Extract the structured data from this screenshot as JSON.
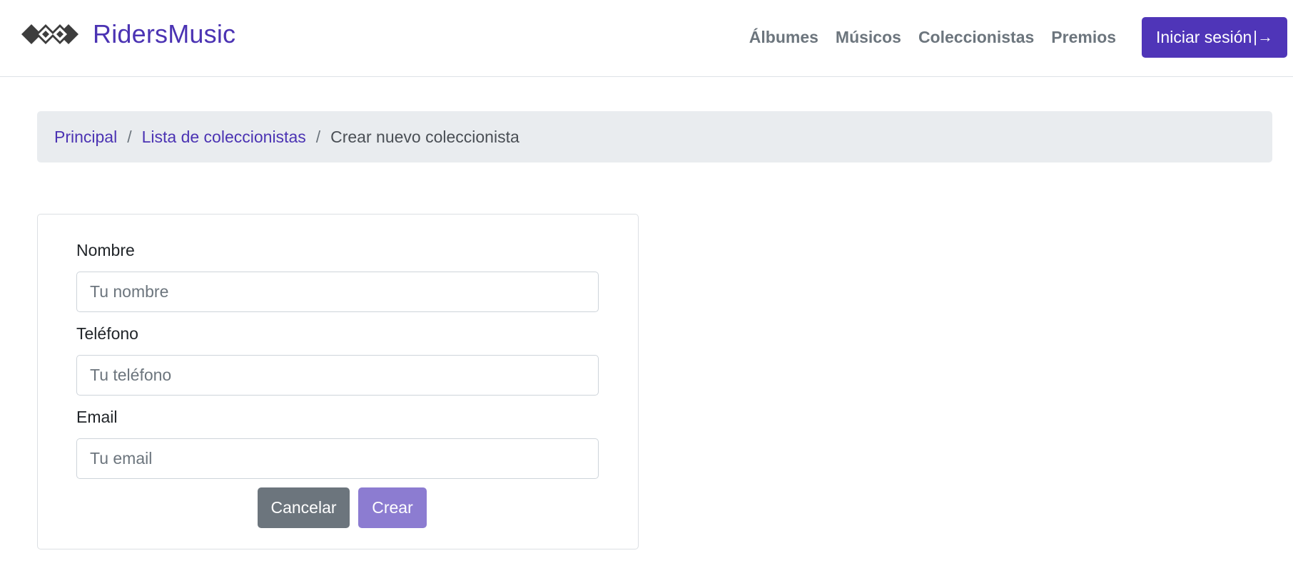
{
  "brand": {
    "name": "RidersMusic",
    "logo_icon": "diamonds-logo-icon"
  },
  "nav": {
    "links": [
      {
        "label": "Álbumes"
      },
      {
        "label": "Músicos"
      },
      {
        "label": "Coleccionistas"
      },
      {
        "label": "Premios"
      }
    ],
    "login_label": "Iniciar sesión",
    "login_icon": "box-arrow-right-icon",
    "login_glyph": "|→"
  },
  "breadcrumb": {
    "items": [
      {
        "label": "Principal"
      },
      {
        "label": "Lista de coleccionistas"
      }
    ],
    "separator": "/",
    "active": "Crear nuevo coleccionista"
  },
  "form": {
    "name": {
      "label": "Nombre",
      "placeholder": "Tu nombre",
      "value": ""
    },
    "phone": {
      "label": "Teléfono",
      "placeholder": "Tu teléfono",
      "value": ""
    },
    "email": {
      "label": "Email",
      "placeholder": "Tu email",
      "value": ""
    },
    "cancel_label": "Cancelar",
    "create_label": "Crear"
  },
  "colors": {
    "accent": "#4f35b8",
    "link": "#4b33b3",
    "nav_text": "#6c757d",
    "breadcrumb_bg": "#e9ecef",
    "cancel_bg": "#6c757d",
    "create_bg_disabled": "#8c7cd1"
  }
}
